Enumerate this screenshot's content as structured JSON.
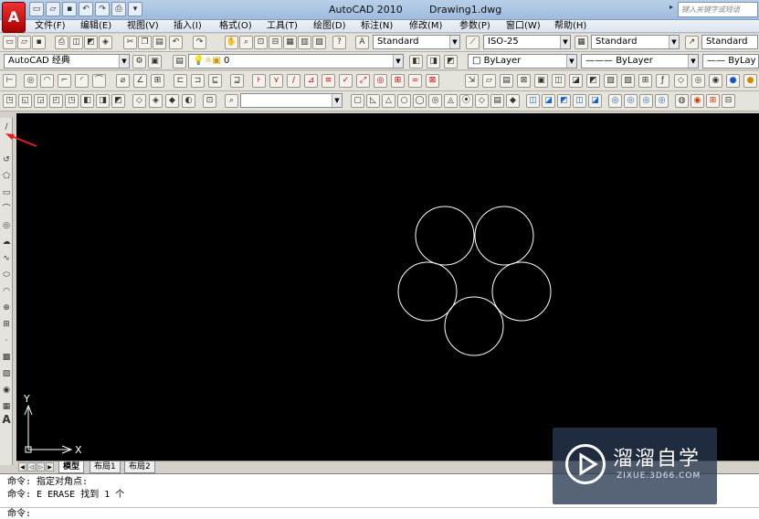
{
  "window": {
    "app_title": "AutoCAD 2010",
    "document_title": "Drawing1.dwg",
    "search_placeholder": "键入关键字或短语"
  },
  "menu": [
    "文件(F)",
    "编辑(E)",
    "视图(V)",
    "插入(I)",
    "格式(O)",
    "工具(T)",
    "绘图(D)",
    "标注(N)",
    "修改(M)",
    "参数(P)",
    "窗口(W)",
    "帮助(H)"
  ],
  "styles_toolbar": {
    "text_style": "Standard",
    "dim_style": "ISO-25",
    "table_style": "Standard",
    "multileader_style": "Standard"
  },
  "workspace_toolbar": {
    "workspace": "AutoCAD 经典",
    "layer": "0",
    "color": "ByLayer",
    "linetype": "ByLayer",
    "lineweight": "ByLay"
  },
  "layout_tabs": [
    "模型",
    "布局1",
    "布局2"
  ],
  "command_line": {
    "history": [
      "命令: 指定对角点:",
      "命令: E ERASE 找到 1 个"
    ],
    "prompt": "命令:"
  },
  "ucs": {
    "x_label": "X",
    "y_label": "Y"
  },
  "watermark": {
    "title": "溜溜自学",
    "subtitle": "ZIXUE.3D66.COM"
  },
  "colors": {
    "canvas": "#000000",
    "circle_stroke": "#ffffff",
    "annotation_arrow": "#e02020"
  }
}
